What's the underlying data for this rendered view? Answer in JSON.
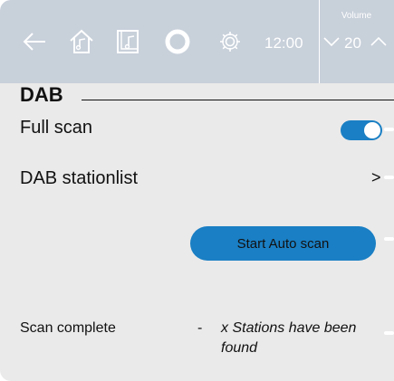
{
  "header": {
    "time": "12:00",
    "volume_label": "Volume",
    "volume_value": "20",
    "icons": [
      "back-arrow-icon",
      "home-icon",
      "music-icon",
      "alexa-icon",
      "settings-gear-icon",
      "chevron-down-icon",
      "chevron-up-icon"
    ]
  },
  "section": {
    "title": "DAB"
  },
  "rows": {
    "full_scan": {
      "label": "Full scan",
      "toggle_on": true
    },
    "stationlist": {
      "label": "DAB stationlist",
      "chevron": ">"
    }
  },
  "actions": {
    "start_auto_scan": "Start Auto scan"
  },
  "status": {
    "label": "Scan complete",
    "separator": "-",
    "message": "x Stations have been found"
  },
  "colors": {
    "header_bg": "#c8d0da",
    "content_bg": "#eaeaea",
    "accent": "#1a7fc4"
  }
}
